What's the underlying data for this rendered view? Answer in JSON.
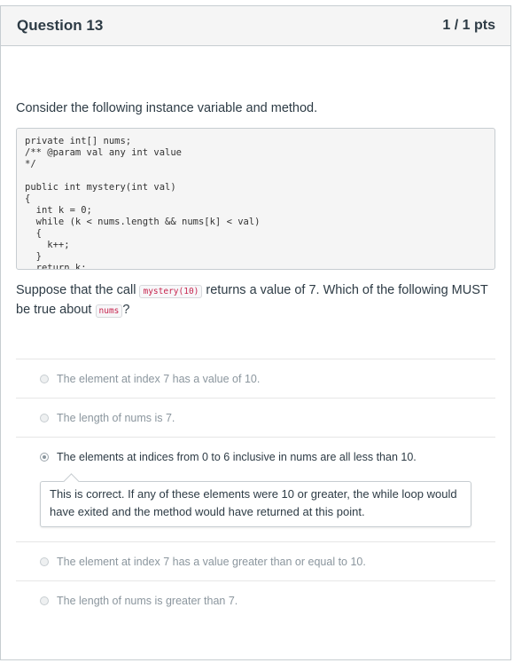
{
  "header": {
    "title": "Question 13",
    "points": "1 / 1 pts"
  },
  "question": {
    "intro": "Consider the following instance variable and method.",
    "code": "private int[] nums;\n/** @param val any int value\n*/\n\npublic int mystery(int val)\n{\n  int k = 0;\n  while (k < nums.length && nums[k] < val)\n  {\n    k++;\n  }\n  return k;\n}",
    "prompt_part1": "Suppose that the call ",
    "prompt_code1": "mystery(10)",
    "prompt_part2": " returns a value of 7. Which of the following MUST be true about ",
    "prompt_code2": "nums",
    "prompt_part3": "?"
  },
  "answers": [
    {
      "label": "The element at index 7 has a value of 10.",
      "selected": false
    },
    {
      "label": "The length of nums is 7.",
      "selected": false
    },
    {
      "label": "The elements at indices from 0 to 6 inclusive in nums are all less than 10.",
      "selected": true
    },
    {
      "label": "The element at index 7 has a value greater than or equal to 10.",
      "selected": false
    },
    {
      "label": "The length of nums is greater than 7.",
      "selected": false
    }
  ],
  "feedback": "This is correct. If any of these elements were 10 or greater, the while loop would have exited and the method would have returned at this point."
}
